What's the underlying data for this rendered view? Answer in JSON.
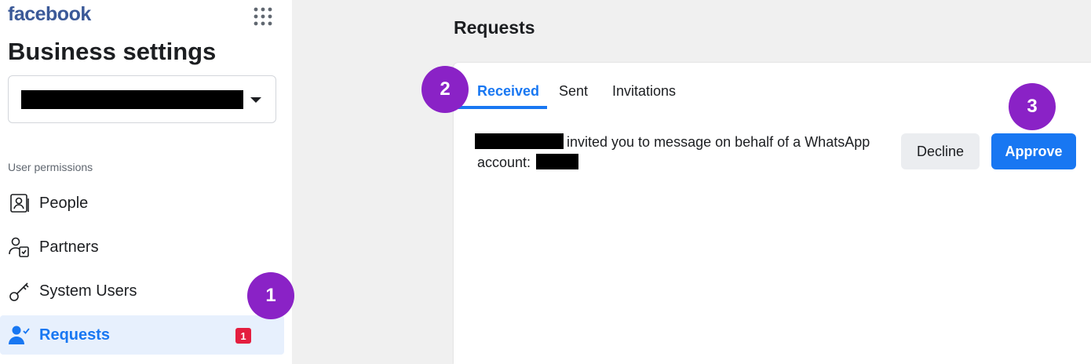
{
  "sidebar": {
    "brand": "facebook",
    "heading": "Business settings",
    "section_label": "User permissions",
    "items": [
      {
        "label": "People",
        "icon": "id-badge-icon"
      },
      {
        "label": "Partners",
        "icon": "partners-icon"
      },
      {
        "label": "System Users",
        "icon": "key-icon"
      },
      {
        "label": "Requests",
        "icon": "user-check-icon",
        "active": true,
        "badge": "1"
      }
    ]
  },
  "main": {
    "title": "Requests",
    "tabs": [
      {
        "label": "Received",
        "active": true
      },
      {
        "label": "Sent"
      },
      {
        "label": "Invitations"
      }
    ],
    "request": {
      "text": "invited you to message on behalf of a WhatsApp",
      "text2": "account:"
    },
    "buttons": {
      "decline": "Decline",
      "approve": "Approve"
    }
  },
  "steps": [
    "1",
    "2",
    "3"
  ],
  "colors": {
    "brand": "#3b5998",
    "accent": "#1877f2",
    "step_marker": "#8a22c6",
    "badge": "#e41e3f"
  }
}
